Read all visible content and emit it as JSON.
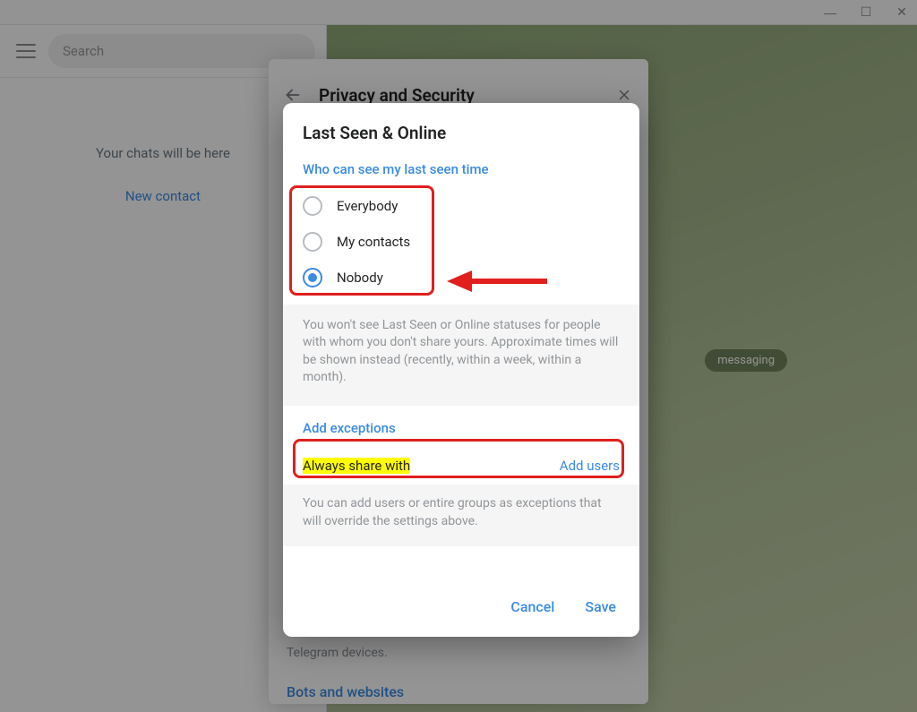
{
  "titlebar": {
    "min": "—",
    "max": "☐",
    "close": "✕"
  },
  "sidebar": {
    "search_placeholder": "Search",
    "empty_label": "Your chats will be here",
    "new_contact": "New contact"
  },
  "chat_bg": {
    "pill": "messaging"
  },
  "privacy_panel": {
    "title": "Privacy and Security",
    "footer_text": "Telegram devices.",
    "footer_link": "Bots and websites"
  },
  "modal": {
    "title": "Last Seen & Online",
    "section1_title": "Who can see my last seen time",
    "options": [
      {
        "label": "Everybody",
        "checked": false
      },
      {
        "label": "My contacts",
        "checked": false
      },
      {
        "label": "Nobody",
        "checked": true
      }
    ],
    "note": "You won't see Last Seen or Online statuses for people with whom you don't share yours. Approximate times will be shown instead (recently, within a week, within a month).",
    "section2_title": "Add exceptions",
    "exception_label": "Always share with",
    "exception_action": "Add users",
    "note2": "You can add users or entire groups as exceptions that will override the settings above.",
    "cancel": "Cancel",
    "save": "Save"
  }
}
